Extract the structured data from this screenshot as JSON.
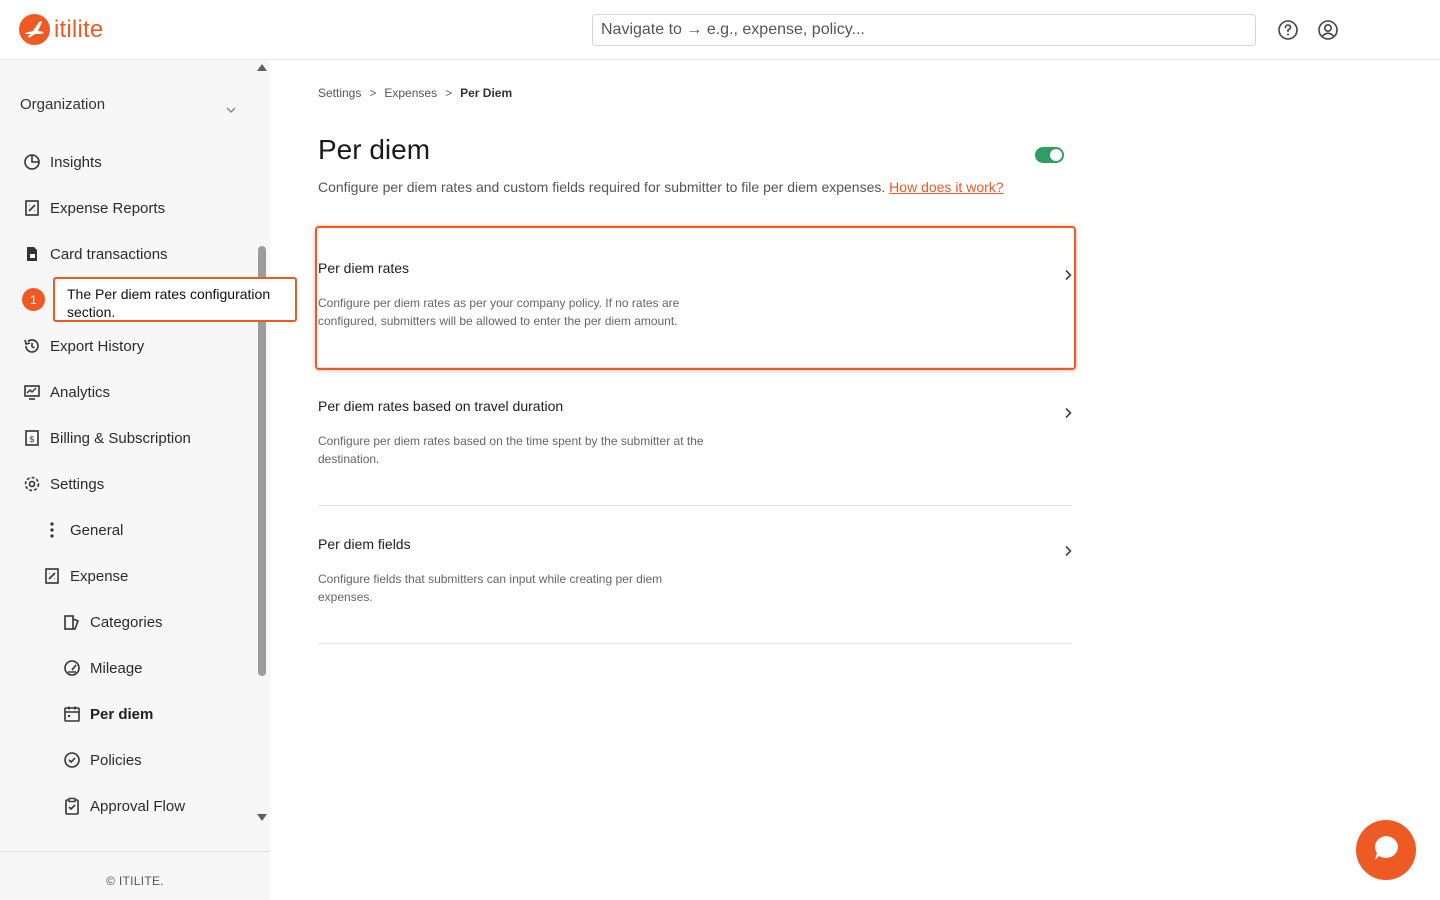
{
  "app": {
    "logo_text": "itilite",
    "brand_color": "#ee5a24",
    "search_placeholder": "Navigate to → e.g., expense, policy...",
    "help_icon": "help-circle-icon",
    "profile_icon": "user-circle-icon"
  },
  "sidebar": {
    "org_label": "Organization",
    "items": [
      {
        "label": "Insights",
        "icon": "pie-chart-icon"
      },
      {
        "label": "Expense Reports",
        "icon": "receipt-icon"
      },
      {
        "label": "Card transactions",
        "icon": "card-doc-icon"
      },
      {
        "label": "Export History",
        "icon": "history-icon"
      },
      {
        "label": "Analytics",
        "icon": "analytics-icon"
      },
      {
        "label": "Billing & Subscription",
        "icon": "billing-icon"
      },
      {
        "label": "Settings",
        "icon": "gear-icon"
      },
      {
        "label": "General",
        "icon": "more-vertical-icon"
      },
      {
        "label": "Expense",
        "icon": "receipt-icon"
      },
      {
        "label": "Categories",
        "icon": "categories-icon"
      },
      {
        "label": "Mileage",
        "icon": "speedometer-icon"
      },
      {
        "label": "Per diem",
        "icon": "calendar-icon",
        "active": true
      },
      {
        "label": "Policies",
        "icon": "check-circle-icon"
      },
      {
        "label": "Approval Flow",
        "icon": "clipboard-check-icon"
      }
    ],
    "footer": "© ITILITE."
  },
  "annotation": {
    "number": "1",
    "text": "The Per diem rates configuration section."
  },
  "breadcrumb": {
    "items": [
      "Settings",
      "Expenses",
      "Per Diem"
    ],
    "separator": ">"
  },
  "page": {
    "title": "Per diem",
    "enabled": true,
    "toggle_color": "#2f9e64",
    "description": "Configure per diem rates and custom fields required for submitter to file per diem expenses.",
    "help_link": "How does it work?"
  },
  "cards": [
    {
      "title": "Per diem rates",
      "description": "Configure per diem rates as per your company policy. If no rates are configured, submitters will be allowed to enter the per diem amount."
    },
    {
      "title": "Per diem rates based on travel duration",
      "description": "Configure per diem rates based on the time spent by the submitter at the destination."
    },
    {
      "title": "Per diem fields",
      "description": "Configure fields that submitters can input while creating per diem expenses."
    }
  ],
  "chat": {
    "icon": "chat-bubble-icon"
  }
}
